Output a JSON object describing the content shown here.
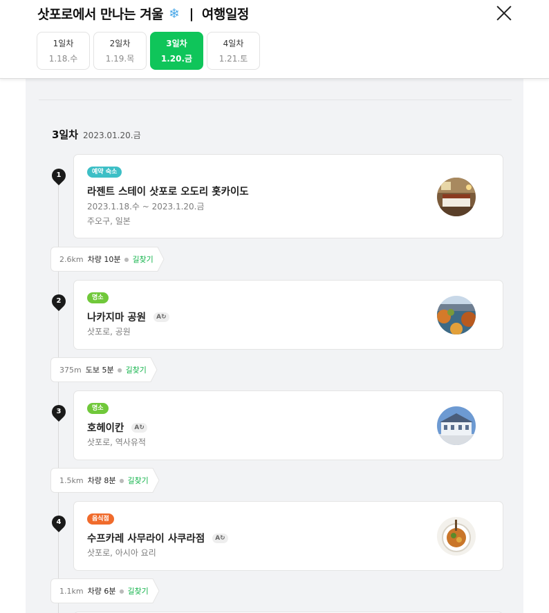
{
  "header": {
    "title": "삿포로에서 만나는 겨울",
    "title_emoji": "❄",
    "separator": "|",
    "subtitle": "여행일정",
    "close_icon": "close-icon"
  },
  "tabs": [
    {
      "label": "1일차",
      "date": "1.18.수",
      "active": false
    },
    {
      "label": "2일차",
      "date": "1.19.목",
      "active": false
    },
    {
      "label": "3일차",
      "date": "1.20.금",
      "active": true
    },
    {
      "label": "4일차",
      "date": "1.21.토",
      "active": false
    }
  ],
  "day": {
    "label": "3일차",
    "date": "2023.01.20.금"
  },
  "colors": {
    "accent": "#0fc55a",
    "link": "#12b34a",
    "teal": "#3dbfc6",
    "green": "#70c83a",
    "orange": "#f06b2c"
  },
  "stops": [
    {
      "num": "1",
      "badge": "예약 숙소",
      "name": "라젠트 스테이 삿포로 오도리 홋카이도",
      "line1": "2023.1.18.수 ~ 2023.1.20.금",
      "line2": "주오구, 일본",
      "translate": ""
    },
    {
      "num": "2",
      "badge": "명소",
      "name": "나카지마 공원",
      "line1": "삿포로, 공원",
      "translate": "A"
    },
    {
      "num": "3",
      "badge": "명소",
      "name": "호헤이칸",
      "line1": "삿포로, 역사유적",
      "translate": "A"
    },
    {
      "num": "4",
      "badge": "음식점",
      "name": "수프카레 사무라이 사쿠라점",
      "line1": "삿포로, 아시아 요리",
      "translate": "A"
    }
  ],
  "routes": [
    {
      "distance": "2.6km",
      "mode": "차량 10분",
      "link": "길찾기"
    },
    {
      "distance": "375m",
      "mode": "도보 5분",
      "link": "길찾기"
    },
    {
      "distance": "1.5km",
      "mode": "차량 8분",
      "link": "길찾기"
    },
    {
      "distance": "1.1km",
      "mode": "차량 6분",
      "link": "길찾기"
    }
  ]
}
